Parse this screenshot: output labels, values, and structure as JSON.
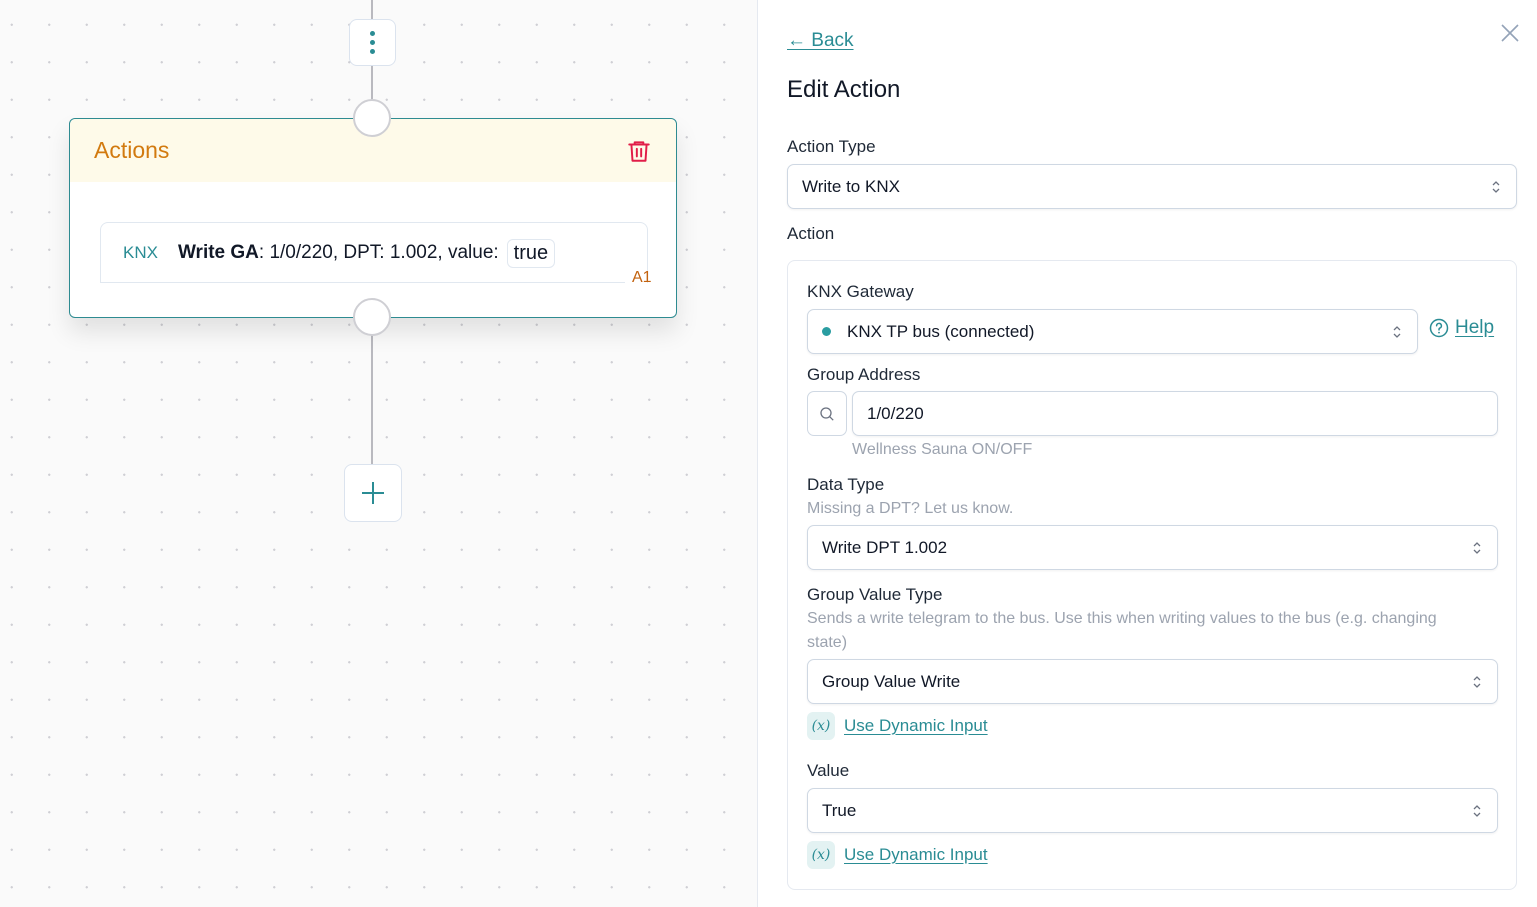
{
  "canvas": {
    "menu_node_icon": "vertical-dots-icon",
    "action_card": {
      "title": "Actions",
      "delete_icon": "trash-icon",
      "item": {
        "integration": "KNX",
        "label_bold": "Write GA",
        "label_rest": ": 1/0/220, DPT: 1.002, value:",
        "value": "true",
        "id": "A1"
      }
    },
    "add_icon": "plus-icon"
  },
  "panel": {
    "back_label": "← Back",
    "title": "Edit Action",
    "close_icon": "close-icon",
    "action_type": {
      "label": "Action Type",
      "value": "Write to KNX"
    },
    "action_section_label": "Action",
    "gateway": {
      "label": "KNX Gateway",
      "value": "KNX TP bus (connected)",
      "status": "connected",
      "status_color": "#2a9da1",
      "help_label": "Help"
    },
    "group_address": {
      "label": "Group Address",
      "value": "1/0/220",
      "hint": "Wellness Sauna ON/OFF"
    },
    "data_type": {
      "label": "Data Type",
      "hint": "Missing a DPT? Let us know.",
      "value": "Write DPT 1.002"
    },
    "group_value_type": {
      "label": "Group Value Type",
      "hint": "Sends a write telegram to the bus. Use this when writing values to the bus (e.g. changing state)",
      "value": "Group Value Write",
      "dynamic_badge": "(x)",
      "dynamic_label": "Use Dynamic Input"
    },
    "value": {
      "label": "Value",
      "value": "True",
      "dynamic_badge": "(x)",
      "dynamic_label": "Use Dynamic Input"
    }
  },
  "colors": {
    "accent": "#2a8c94",
    "card_title": "#d27a0f",
    "delete": "#e11d48",
    "item_id": "#c2620f"
  }
}
